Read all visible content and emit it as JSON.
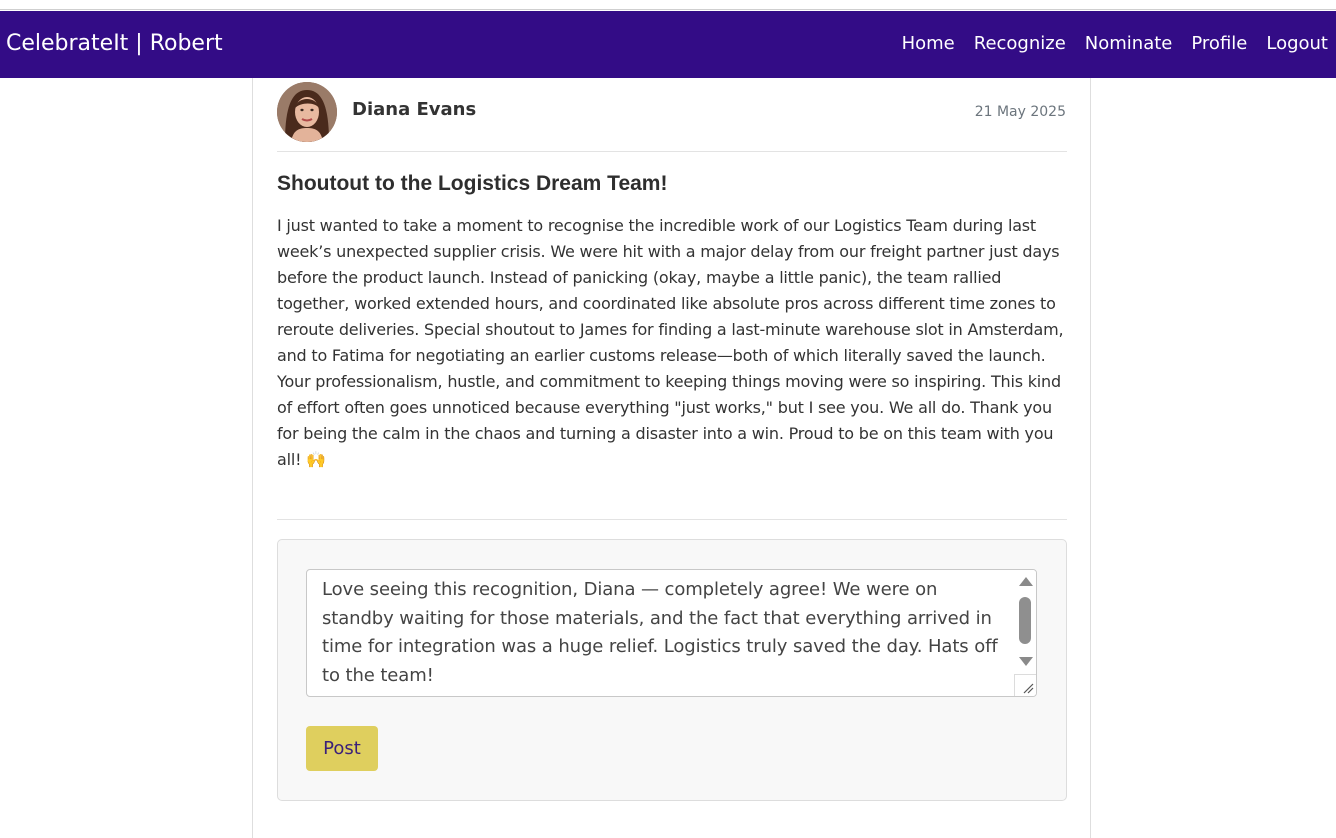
{
  "navbar": {
    "brand": "CelebrateIt | Robert",
    "links": [
      "Home",
      "Recognize",
      "Nominate",
      "Profile",
      "Logout"
    ]
  },
  "post": {
    "author": "Diana Evans",
    "date": "21 May 2025",
    "title": "Shoutout to the Logistics Dream Team!",
    "body": "I just wanted to take a moment to recognise the incredible work of our Logistics Team during last week’s unexpected supplier crisis. We were hit with a major delay from our freight partner just days before the product launch. Instead of panicking (okay, maybe a little panic), the team rallied together, worked extended hours, and coordinated like absolute pros across different time zones to reroute deliveries. Special shoutout to James for finding a last-minute warehouse slot in Amsterdam, and to Fatima for negotiating an earlier customs release—both of which literally saved the launch. Your professionalism, hustle, and commitment to keeping things moving were so inspiring. This kind of effort often goes unnoticed because everything \"just works,\" but I see you. We all do. Thank you for being the calm in the chaos and turning a disaster into a win. Proud to be on this team with you all! 🙌"
  },
  "comment": {
    "value": "Love seeing this recognition, Diana — completely agree! We were on standby waiting for those materials, and the fact that everything arrived in time for integration was a huge relief. Logistics truly saved the day. Hats off to the team!",
    "post_label": "Post"
  },
  "colors": {
    "navbar_bg": "#330c86",
    "post_button_bg": "#dfcf5e",
    "post_button_text": "#3a1f7a"
  }
}
